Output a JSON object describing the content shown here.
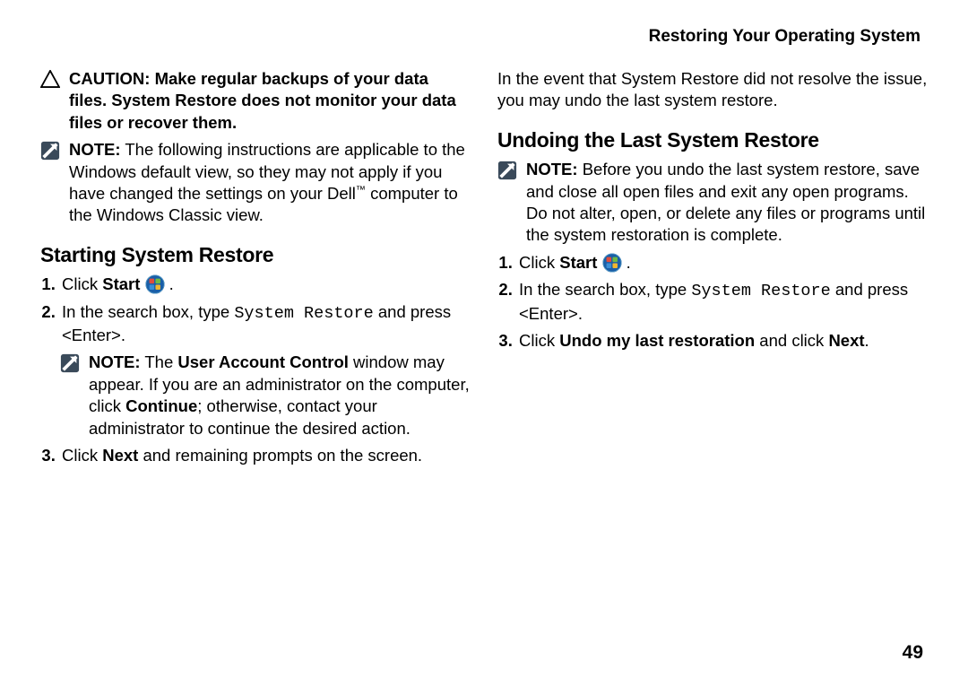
{
  "header": "Restoring Your Operating System",
  "caution_label": "CAUTION:",
  "caution_text": " Make regular backups of your data files. System Restore does not monitor your data files or recover them.",
  "note_label": "NOTE:",
  "note1_text_a": " The following instructions are applicable to the Windows default view, so they may not apply if you have changed the settings on your Dell",
  "note1_tm": "™",
  "note1_text_b": " computer to the Windows Classic view.",
  "section1_heading": "Starting System Restore",
  "s1_step1_a": "Click ",
  "s1_step1_b": "Start",
  "s1_step1_c": " .",
  "s1_step2_a": "In the search box, type ",
  "s1_step2_code": "System Restore",
  "s1_step2_b": " and press <Enter>.",
  "note2_text_a": " The ",
  "note2_text_uac": "User Account Control",
  "note2_text_b": " window may appear. If you are an administrator on the computer, click ",
  "note2_text_continue": "Continue",
  "note2_text_c": "; otherwise, contact your administrator to continue the desired action.",
  "s1_step3_a": "Click ",
  "s1_step3_b": "Next",
  "s1_step3_c": " and remaining prompts on the screen.",
  "col2_intro": "In the event that System Restore did not resolve the issue, you may undo the last system restore.",
  "section2_heading": "Undoing the Last System Restore",
  "note3_text": " Before you undo the last system restore, save and close all open files and exit any open programs. Do not alter, open, or delete any files or programs until the system restoration is complete.",
  "s2_step1_a": "Click ",
  "s2_step1_b": "Start",
  "s2_step1_c": " .",
  "s2_step2_a": "In the search box, type ",
  "s2_step2_code": "System Restore",
  "s2_step2_b": " and press <Enter>.",
  "s2_step3_a": "Click ",
  "s2_step3_b": "Undo my last restoration",
  "s2_step3_c": " and click ",
  "s2_step3_d": "Next",
  "s2_step3_e": ".",
  "page_number": "49"
}
